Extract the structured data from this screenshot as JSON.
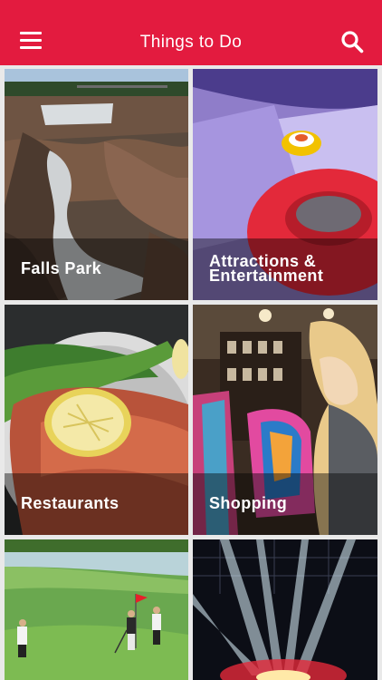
{
  "header": {
    "title": "Things to Do",
    "menu_icon": "hamburger-menu-icon",
    "search_icon": "search-icon",
    "accent_color": "#e31b3f"
  },
  "tiles": [
    {
      "label": "Falls Park"
    },
    {
      "label": "Attractions &\nEntertainment"
    },
    {
      "label": "Restaurants"
    },
    {
      "label": "Shopping"
    },
    {
      "label": ""
    },
    {
      "label": ""
    }
  ]
}
